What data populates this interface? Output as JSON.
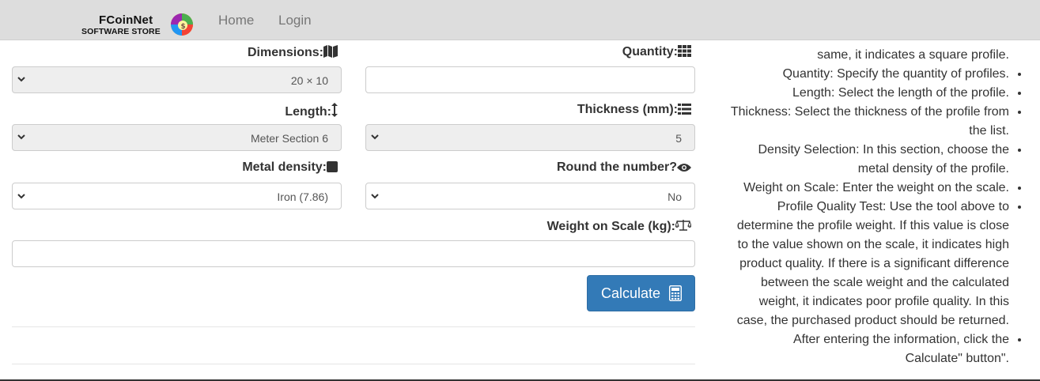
{
  "brand": {
    "name": "FCoinNet",
    "subtitle": "SOFTWARE STORE",
    "logo_colors": [
      "#4caf50",
      "#2196f3",
      "#f44336",
      "#ff9800",
      "#9c27b0"
    ]
  },
  "nav": {
    "home": "Home",
    "login": "Login"
  },
  "form": {
    "dimensions": {
      "label": ":Dimensions",
      "icon": "map-icon",
      "value": "20 × 10"
    },
    "quantity": {
      "label": ":Quantity",
      "icon": "grid-icon",
      "value": ""
    },
    "length": {
      "label": ":Length",
      "icon": "resize-vertical-icon",
      "value": "Meter Section 6"
    },
    "thickness": {
      "label": ":Thickness (mm)",
      "icon": "list-icon",
      "value": "5"
    },
    "metal_density": {
      "label": ":Metal density",
      "icon": "square-icon",
      "value": "Iron (7.86)"
    },
    "round": {
      "label": "?Round the number",
      "icon": "eye-icon",
      "value": "No"
    },
    "weight": {
      "label": ":Weight on Scale (kg)",
      "icon": "scale-icon",
      "value": ""
    },
    "calculate_label": "Calculate",
    "accent": "#337ab7"
  },
  "help": {
    "lines": [
      ".same, it indicates a square profile",
      ".Quantity: Specify the quantity of profiles",
      ".Length: Select the length of the profile",
      "Thickness: Select the thickness of the profile from",
      ".the list",
      "Density Selection: In this section, choose the",
      ".metal density of the profile",
      ".Weight on Scale: Enter the weight on the scale",
      "Profile Quality Test: Use the tool above to",
      "determine the profile weight. If this value is close",
      "to the value shown on the scale, it indicates high",
      "product quality. If there is a significant difference",
      "between the scale weight and the calculated",
      "weight, it indicates poor profile quality. In this",
      ".case, the purchased product should be returned",
      "After entering the information, click the",
      ".\"Calculate\" button"
    ]
  }
}
